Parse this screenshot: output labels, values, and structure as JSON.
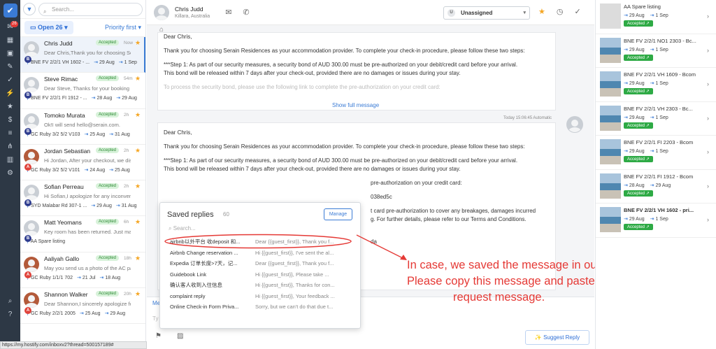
{
  "url": "https://my.hostify.com/inboxv2?thread=500157189#",
  "rail": {
    "badge": "26"
  },
  "inbox": {
    "search_placeholder": "Search...",
    "open_label": "Open",
    "open_count": "26",
    "sort_label": "Priority first",
    "conversations": [
      {
        "name": "Chris Judd",
        "status": "Accepted",
        "age": "Now",
        "msg": "Dear Chris,Thank you for choosing Serai...",
        "listing": "BNE FV 2/2/1 VH 1602 - ...",
        "checkin": "29 Aug",
        "checkout": "1 Sep",
        "source": "B"
      },
      {
        "name": "Steve Rimac",
        "status": "Accepted",
        "age": "54m",
        "msg": "Dear Steve, Thanks for your booking wit...",
        "listing": "BNE FV 2/2/1 FI 1912 - ...",
        "checkin": "28 Aug",
        "checkout": "29 Aug",
        "source": "B"
      },
      {
        "name": "Tomoko Murata",
        "status": "Accepted",
        "age": "2h",
        "msg": "Ok!I will send hello@serain.com.",
        "listing": "GC Ruby 3/2 5/2 V103",
        "checkin": "25 Aug",
        "checkout": "31 Aug",
        "source": "B"
      },
      {
        "name": "Jordan Sebastian",
        "status": "Accepted",
        "age": "2h",
        "msg": "Hi Jordan,  After your checkout, we disc...",
        "listing": "GC Ruby 3/2 5/2 V101",
        "checkin": "24 Aug",
        "checkout": "25 Aug",
        "source": "A"
      },
      {
        "name": "Sofian Perreau",
        "status": "Accepted",
        "age": "2h",
        "msg": "Hi Sofian,I apologize for any inconvenien...",
        "listing": "SYD Malabar Rd 307-1 ...",
        "checkin": "29 Aug",
        "checkout": "31 Aug",
        "source": "B"
      },
      {
        "name": "Matt Yeomans",
        "status": "Accepted",
        "age": "6h",
        "msg": "Key room has been returned. Just make ...",
        "listing": "AA Spare listing",
        "checkin": "",
        "checkout": "",
        "source": "B"
      },
      {
        "name": "Aaliyah Gallo",
        "status": "Accepted",
        "age": "18h",
        "msg": "May you send us a photo of the AC pane...",
        "listing": "GC Ruby 1/1/1 702",
        "checkin": "21 Jul",
        "checkout": "18 Aug",
        "source": "A"
      },
      {
        "name": "Shannon Walker",
        "status": "Accepted",
        "age": "20h",
        "msg": "Dear Shannon,I sincerely apologize for ...",
        "listing": "GC Ruby 2/2/1 2005",
        "checkin": "25 Aug",
        "checkout": "29 Aug",
        "source": "A"
      }
    ]
  },
  "header": {
    "name": "Chris Judd",
    "location": "Killara, Australia",
    "assignee": "Unassigned",
    "assignee_initial": "U"
  },
  "message1": {
    "greeting": "Dear Chris,",
    "p1": "Thank you for choosing Serain Residences as your accommodation provider. To complete your check-in procedure, please follow these two steps:",
    "p2": "***Step 1: As part of our security measures, a security bond of AUD 300.00 must be pre-authorized on your debit/credit card before your arrival.",
    "p3": "This bond will be released within 7 days after your check-out, provided there are no damages or issues during your stay.",
    "p4": "To process the security bond, please use the following link to complete the pre-authorization on your credit card:",
    "show_full": "Show full message"
  },
  "timestamp": "Today 15:06:45  Automatic",
  "message2": {
    "greeting": "Dear Chris,",
    "p1": "Thank you for choosing Serain Residences as your accommodation provider. To complete your check-in procedure, please follow these two steps:",
    "p2": "***Step 1: As part of our security measures, a security bond of AUD 300.00 must be pre-authorized on your debit/credit card before your arrival.",
    "p3": "This bond will be released within 7 days after your check-out, provided there are no damages or issues during your stay.",
    "p4": "pre-authorization on your credit card:",
    "p5": "038ed5c",
    "p6": "t card pre-authorization to cover any breakages, damages incurred",
    "p7": "g. For further details, please refer to our Terms and Conditions.",
    "p8": "da"
  },
  "compose": {
    "tab": "Me",
    "suggest": "Suggest Reply",
    "hint": "Ty"
  },
  "saved_replies": {
    "title": "Saved replies",
    "count": "60",
    "manage": "Manage",
    "search_placeholder": "Search...",
    "items": [
      {
        "title": "airbnb以外平台 收deposit 和...",
        "preview": "Dear {{guest_first}}, Thank you f..."
      },
      {
        "title": "Airbnb Change reservation ...",
        "preview": "Hi {{guest_first}}, I've sent the al..."
      },
      {
        "title": "Expedia 订单长度>7天，记...",
        "preview": "Dear {{guest_first}}, Thank you f..."
      },
      {
        "title": "Guidebook Link",
        "preview": "Hi {{guest_first}}, Please take ..."
      },
      {
        "title": "确认客人收到入住信息",
        "preview": "Hi {{guest_first}}, Thanks for con..."
      },
      {
        "title": "complaint reply",
        "preview": "Hi {{guest_first}}, Your feedback ..."
      },
      {
        "title": "Online Check-in Form Priva...",
        "preview": "Sorry, but we can't do that due t..."
      }
    ]
  },
  "right_panel": {
    "listings": [
      {
        "title": "AA Spare listing",
        "checkin": "29 Aug",
        "checkout": "1 Sep",
        "status": "Accepted",
        "bold": false,
        "img": false
      },
      {
        "title": "BNE FV 2/2/1 NO1 2303 - Bc...",
        "checkin": "29 Aug",
        "checkout": "1 Sep",
        "status": "Accepted",
        "bold": false,
        "img": true
      },
      {
        "title": "BNE FV 2/2/1 VH 1609 - Bcom",
        "checkin": "29 Aug",
        "checkout": "1 Sep",
        "status": "Accepted",
        "bold": false,
        "img": true
      },
      {
        "title": "BNE FV 2/2/1 VH 2303 - Bc...",
        "checkin": "29 Aug",
        "checkout": "1 Sep",
        "status": "Accepted",
        "bold": false,
        "img": true
      },
      {
        "title": "BNE FV 2/2/1 FI 2203 - Bcom",
        "checkin": "29 Aug",
        "checkout": "1 Sep",
        "status": "Accepted",
        "bold": false,
        "img": true
      },
      {
        "title": "BNE FV 2/2/1 FI 1912 - Bcom",
        "checkin": "28 Aug",
        "checkout": "29 Aug",
        "status": "Accepted",
        "bold": false,
        "img": true
      },
      {
        "title": "BNE FV 2/2/1 VH 1602 - pri...",
        "checkin": "29 Aug",
        "checkout": "1 Sep",
        "status": "Accepted",
        "bold": true,
        "img": true
      }
    ]
  },
  "annotation": {
    "line1": "In case, we saved the message in our saved reply.",
    "line2": "Please copy this message and paste into the payment",
    "line3": "request message."
  }
}
